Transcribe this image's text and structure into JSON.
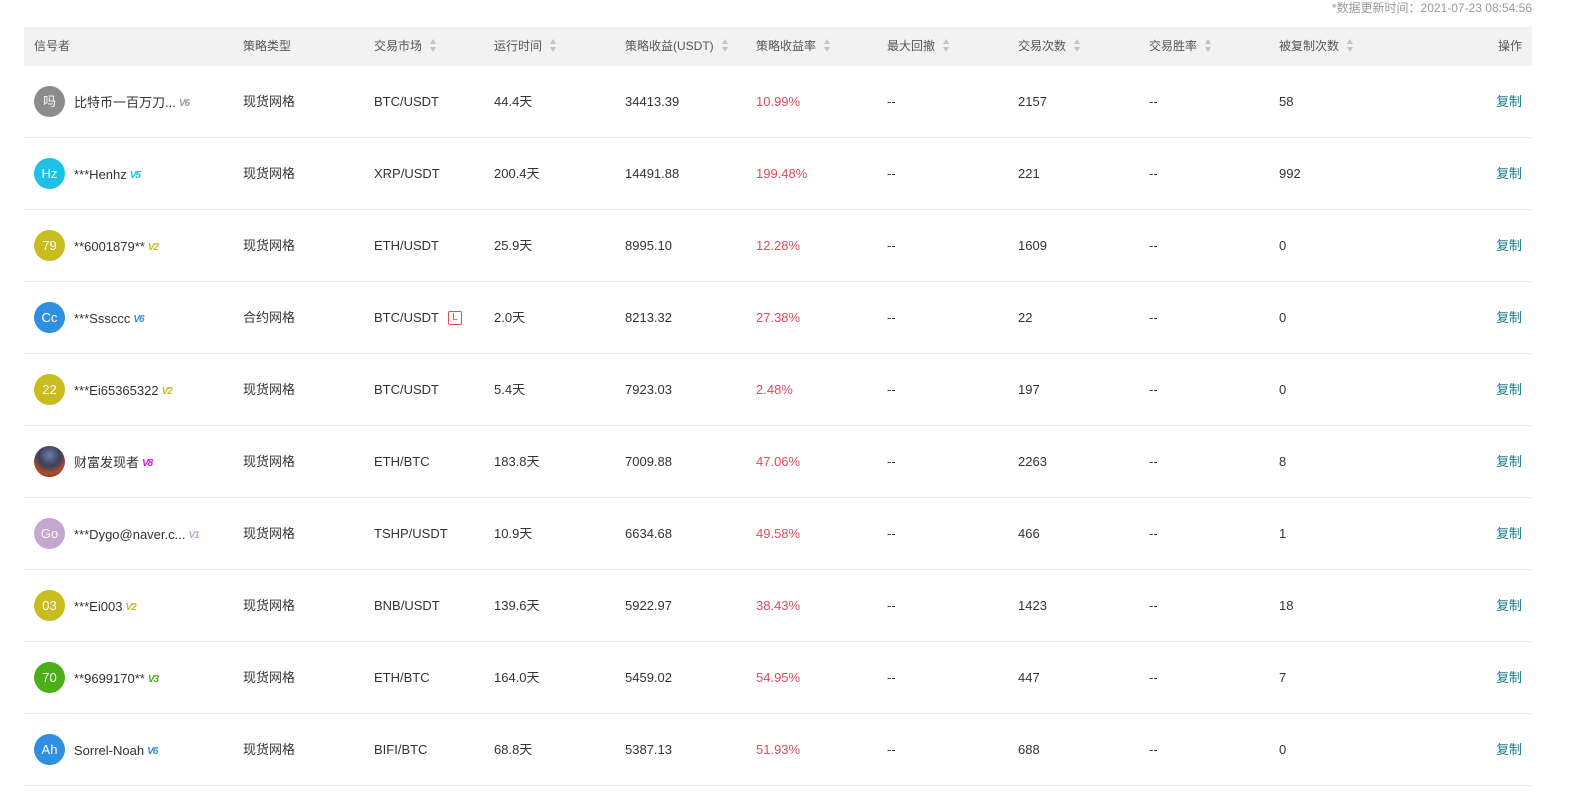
{
  "update_time": "*数据更新时间：2021-07-23 08:54:56",
  "headers": {
    "user": "信号者",
    "type": "策略类型",
    "market": "交易市场",
    "time": "运行时间",
    "profit": "策略收益(USDT)",
    "rate": "策略收益率",
    "drawdown": "最大回撤",
    "trades": "交易次数",
    "winrate": "交易胜率",
    "copies": "被复制次数",
    "action": "操作"
  },
  "rows": [
    {
      "avatar": "吗",
      "avatar_color": "#8c8c8c",
      "name": "比特币一百万刀...",
      "vip": "V6",
      "vip_color": "#9a9a9a",
      "type": "现货网格",
      "market": "BTC/USDT",
      "tag": "",
      "time": "44.4天",
      "profit": "34413.39",
      "rate": "10.99%",
      "drawdown": "--",
      "trades": "2157",
      "winrate": "--",
      "copies": "58",
      "action": "复制"
    },
    {
      "avatar": "Hz",
      "avatar_color": "#1ec0e6",
      "name": "***Henhz",
      "vip": "V5",
      "vip_color": "#1ec0e6",
      "type": "现货网格",
      "market": "XRP/USDT",
      "tag": "",
      "time": "200.4天",
      "profit": "14491.88",
      "rate": "199.48%",
      "drawdown": "--",
      "trades": "221",
      "winrate": "--",
      "copies": "992",
      "action": "复制"
    },
    {
      "avatar": "79",
      "avatar_color": "#c9bc1f",
      "name": "**6001879**",
      "vip": "V2",
      "vip_color": "#c9bc1f",
      "type": "现货网格",
      "market": "ETH/USDT",
      "tag": "",
      "time": "25.9天",
      "profit": "8995.10",
      "rate": "12.28%",
      "drawdown": "--",
      "trades": "1609",
      "winrate": "--",
      "copies": "0",
      "action": "复制"
    },
    {
      "avatar": "Cc",
      "avatar_color": "#2f8fe0",
      "name": "***Sssccc",
      "vip": "V6",
      "vip_color": "#2f8fe0",
      "type": "合约网格",
      "market": "BTC/USDT",
      "tag": "L",
      "time": "2.0天",
      "profit": "8213.32",
      "rate": "27.38%",
      "drawdown": "--",
      "trades": "22",
      "winrate": "--",
      "copies": "0",
      "action": "复制"
    },
    {
      "avatar": "22",
      "avatar_color": "#c9bc1f",
      "name": "***Ei65365322",
      "vip": "V2",
      "vip_color": "#c9bc1f",
      "type": "现货网格",
      "market": "BTC/USDT",
      "tag": "",
      "time": "5.4天",
      "profit": "7923.03",
      "rate": "2.48%",
      "drawdown": "--",
      "trades": "197",
      "winrate": "--",
      "copies": "0",
      "action": "复制"
    },
    {
      "avatar": "",
      "avatar_color": "photo",
      "name": "财富发现者",
      "vip": "V8",
      "vip_color": "#d21ad6",
      "type": "现货网格",
      "market": "ETH/BTC",
      "tag": "",
      "time": "183.8天",
      "profit": "7009.88",
      "rate": "47.06%",
      "drawdown": "--",
      "trades": "2263",
      "winrate": "--",
      "copies": "8",
      "action": "复制"
    },
    {
      "avatar": "Go",
      "avatar_color": "#c4a8d0",
      "name": "***Dygo@naver.c...",
      "vip": "V1",
      "vip_color": "#c4a8d0",
      "type": "现货网格",
      "market": "TSHP/USDT",
      "tag": "",
      "time": "10.9天",
      "profit": "6634.68",
      "rate": "49.58%",
      "drawdown": "--",
      "trades": "466",
      "winrate": "--",
      "copies": "1",
      "action": "复制"
    },
    {
      "avatar": "03",
      "avatar_color": "#c9bc1f",
      "name": "***Ei003",
      "vip": "V2",
      "vip_color": "#c9bc1f",
      "type": "现货网格",
      "market": "BNB/USDT",
      "tag": "",
      "time": "139.6天",
      "profit": "5922.97",
      "rate": "38.43%",
      "drawdown": "--",
      "trades": "1423",
      "winrate": "--",
      "copies": "18",
      "action": "复制"
    },
    {
      "avatar": "70",
      "avatar_color": "#4caf1a",
      "name": "**9699170**",
      "vip": "V3",
      "vip_color": "#4caf1a",
      "type": "现货网格",
      "market": "ETH/BTC",
      "tag": "",
      "time": "164.0天",
      "profit": "5459.02",
      "rate": "54.95%",
      "drawdown": "--",
      "trades": "447",
      "winrate": "--",
      "copies": "7",
      "action": "复制"
    },
    {
      "avatar": "Ah",
      "avatar_color": "#2f8fe0",
      "name": "Sorrel-Noah",
      "vip": "V6",
      "vip_color": "#2f8fe0",
      "type": "现货网格",
      "market": "BIFI/BTC",
      "tag": "",
      "time": "68.8天",
      "profit": "5387.13",
      "rate": "51.93%",
      "drawdown": "--",
      "trades": "688",
      "winrate": "--",
      "copies": "0",
      "action": "复制"
    }
  ]
}
